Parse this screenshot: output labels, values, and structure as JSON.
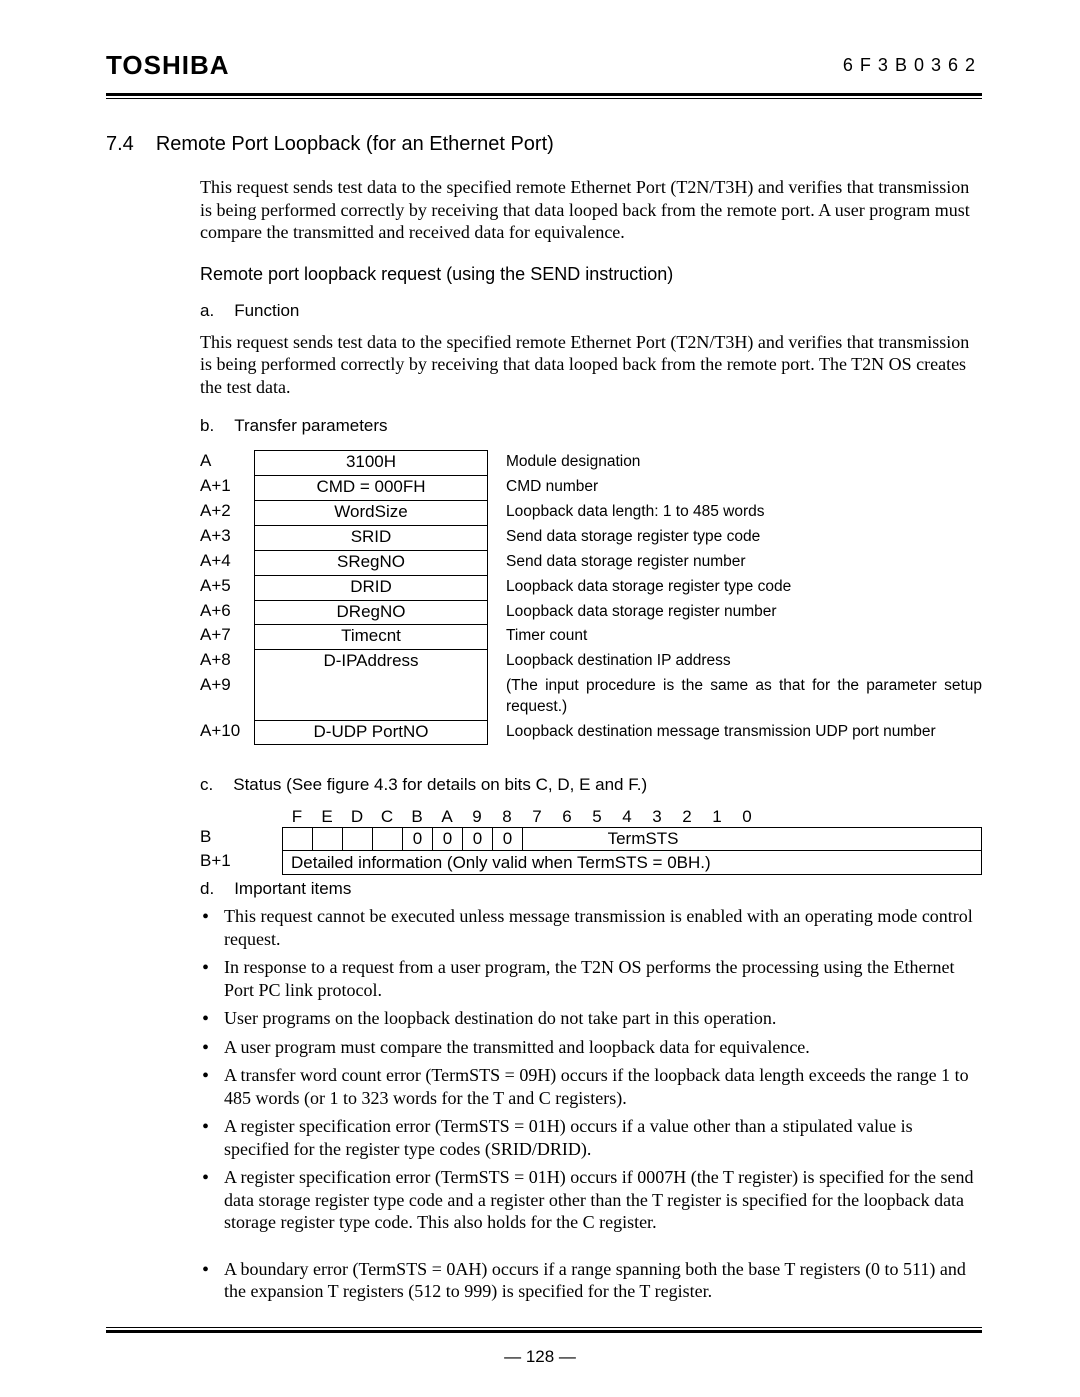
{
  "header": {
    "brand": "TOSHIBA",
    "doc_code": "6F3B0362"
  },
  "section": {
    "number": "7.4",
    "title": "Remote Port Loopback (for an Ethernet Port)"
  },
  "intro_para": "This request sends test data to the specified remote Ethernet Port (T2N/T3H) and verifies that transmission is being performed correctly by receiving that data looped back from the remote port. A user program must compare the transmitted and received data for equivalence.",
  "sub_title": "Remote port loopback request (using the SEND instruction)",
  "item_a": {
    "letter": "a.",
    "label": "Function"
  },
  "func_para": "This request sends test data to the specified remote Ethernet Port (T2N/T3H) and verifies that transmission is being performed correctly by receiving that data looped back from the remote port. The T2N OS creates the test data.",
  "item_b": {
    "letter": "b.",
    "label": "Transfer parameters"
  },
  "params": [
    {
      "addr": "A",
      "val": "3100H",
      "desc": "Module designation"
    },
    {
      "addr": "A+1",
      "val": "CMD = 000FH",
      "desc": "CMD number"
    },
    {
      "addr": "A+2",
      "val": "WordSize",
      "desc": "Loopback data length: 1 to 485 words"
    },
    {
      "addr": "A+3",
      "val": "SRID",
      "desc": "Send data storage register type code"
    },
    {
      "addr": "A+4",
      "val": "SRegNO",
      "desc": "Send data storage register number"
    },
    {
      "addr": "A+5",
      "val": "DRID",
      "desc": "Loopback data storage register type code"
    },
    {
      "addr": "A+6",
      "val": "DRegNO",
      "desc": "Loopback data storage register number"
    },
    {
      "addr": "A+7",
      "val": "Timecnt",
      "desc": "Timer count"
    },
    {
      "addr": "A+8",
      "val": "D-IPAddress",
      "desc": "Loopback destination IP address"
    },
    {
      "addr": "A+9",
      "val": "",
      "desc": "(The input procedure is the same as that for the parameter setup request.)"
    },
    {
      "addr": "A+10",
      "val": "D-UDP PortNO",
      "desc": "Loopback destination message transmission UDP port number"
    }
  ],
  "item_c": {
    "letter": "c.",
    "label": "Status (See figure 4.3 for details on bits C, D, E and F.)"
  },
  "status": {
    "bits": [
      "F",
      "E",
      "D",
      "C",
      "B",
      "A",
      "9",
      "8",
      "7",
      "6",
      "5",
      "4",
      "3",
      "2",
      "1",
      "0"
    ],
    "row_b_label": "B",
    "row_b_cells": [
      "",
      "",
      "",
      "",
      "0",
      "0",
      "0",
      "0"
    ],
    "row_b_term": "TermSTS",
    "row_b1_label": "B+1",
    "row_b1_text": "Detailed information (Only valid when TermSTS = 0BH.)"
  },
  "item_d": {
    "letter": "d.",
    "label": "Important items"
  },
  "bullets": [
    "This request cannot be executed unless message transmission is enabled with an operating mode control request.",
    "In response to a request from a user program, the T2N OS performs the processing using the Ethernet Port PC link protocol.",
    "User programs on the loopback destination do not take part in this operation.",
    "A user program must compare the transmitted and loopback data for equivalence.",
    "A transfer word count error (TermSTS = 09H) occurs if the loopback data length exceeds the range 1 to 485 words (or 1 to 323 words for the T and C registers).",
    "A register specification error (TermSTS = 01H) occurs if a value other than a stipulated value is specified for the register type codes (SRID/DRID).",
    "A register specification error (TermSTS = 01H) occurs if 0007H (the T register) is specified for the send data storage register type code and a register other than the T register is specified for the loopback data storage register type code. This also holds for the C register."
  ],
  "bullets2": [
    "A boundary error (TermSTS = 0AH) occurs if a range spanning both the base T registers (0 to 511) and the expansion T registers (512 to 999) is specified for the T register."
  ],
  "page_number": "— 128 —"
}
